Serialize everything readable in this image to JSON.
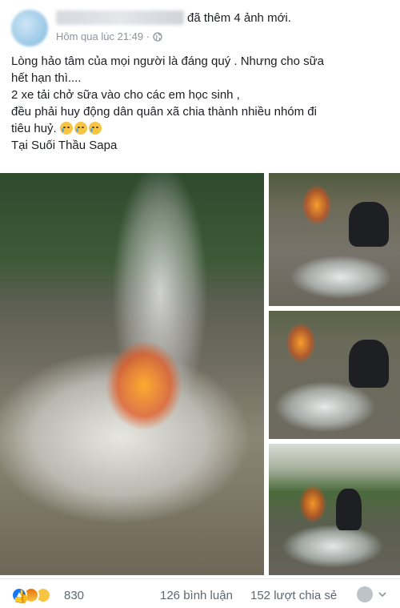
{
  "post": {
    "added_text": "đã thêm 4 ảnh mới.",
    "timestamp": "Hôm qua lúc 21:49 ·",
    "caption_lines": [
      "Lòng hảo tâm của mọi người là đáng quý . Nhưng cho sữa",
      "hết hạn thì....",
      "2 xe tải chở sữa vào cho các em học sinh ,",
      "đều phải huy động dân quân xã chia thành nhiều nhóm đi",
      "tiêu huỷ.",
      "Tại Suối Thầu Sapa"
    ],
    "emojis": [
      "sad-tear-emoji",
      "sad-tear-emoji",
      "sad-tear-emoji"
    ],
    "privacy_icon": "globe-icon"
  },
  "photos": [
    {
      "name": "photo-fire-large"
    },
    {
      "name": "photo-man-crouching-1"
    },
    {
      "name": "photo-man-crouching-2"
    },
    {
      "name": "photo-man-crouching-3"
    }
  ],
  "engagement": {
    "reaction_icons": [
      "like-icon",
      "angry-icon",
      "sad-icon"
    ],
    "reaction_count": "830",
    "comments": "126 bình luận",
    "shares": "152 lượt chia sẻ"
  },
  "colors": {
    "meta_gray": "#8d949e",
    "like_blue": "#1877f2"
  }
}
